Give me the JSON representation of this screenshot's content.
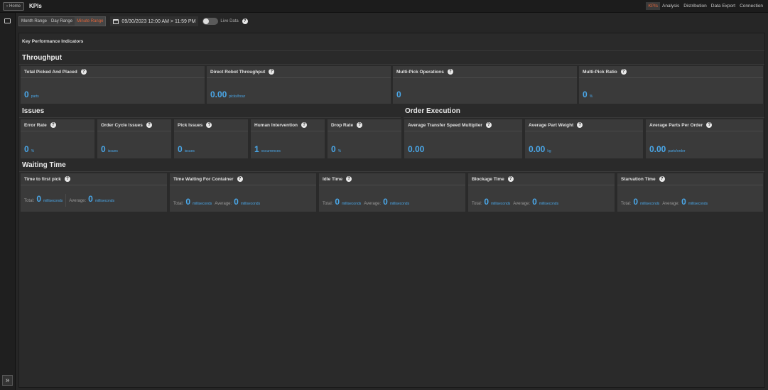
{
  "header": {
    "home_label": "Home",
    "title": "KPIs",
    "nav": [
      "KPIs",
      "Analysis",
      "Distribution",
      "Data Export",
      "Connection"
    ],
    "nav_active": "KPIs"
  },
  "toolbar": {
    "ranges": [
      "Month Range",
      "Day Range",
      "Minute Range"
    ],
    "range_active": "Minute Range",
    "date_range": "09/30/2023 12:00 AM > 11:59 PM",
    "live_label": "Live Data",
    "live_on": false
  },
  "panel": {
    "title": "Key Performance Indicators"
  },
  "throughput": {
    "title": "Throughput",
    "cards": [
      {
        "label": "Total Picked And Placed",
        "value": "0",
        "unit": "parts"
      },
      {
        "label": "Direct Robot Throughput",
        "value": "0.00",
        "unit": "picks/hour"
      },
      {
        "label": "Multi-Pick Operations",
        "value": "0",
        "unit": ""
      },
      {
        "label": "Multi-Pick Ratio",
        "value": "0",
        "unit": "%"
      }
    ]
  },
  "issues": {
    "title": "Issues",
    "cards": [
      {
        "label": "Error Rate",
        "value": "0",
        "unit": "%"
      },
      {
        "label": "Order Cycle Issues",
        "value": "0",
        "unit": "issues"
      },
      {
        "label": "Pick Issues",
        "value": "0",
        "unit": "issues"
      },
      {
        "label": "Human Intervention",
        "value": "1",
        "unit": "occurrences"
      },
      {
        "label": "Drop Rate",
        "value": "0",
        "unit": "%"
      }
    ]
  },
  "order_execution": {
    "title": "Order Execution",
    "cards": [
      {
        "label": "Average Transfer Speed Multiplier",
        "value": "0.00",
        "unit": ""
      },
      {
        "label": "Average Part Weight",
        "value": "0.00",
        "unit": "kg"
      },
      {
        "label": "Average Parts Per Order",
        "value": "0.00",
        "unit": "parts/order"
      }
    ]
  },
  "waiting_time": {
    "title": "Waiting Time",
    "total_label": "Total:",
    "average_label": "Average:",
    "cards": [
      {
        "label": "Time to first pick",
        "total": "0",
        "average": "0",
        "unit": "milliseconds"
      },
      {
        "label": "Time Waiting For Container",
        "total": "0",
        "average": "0",
        "unit": "milliseconds"
      },
      {
        "label": "Idle Time",
        "total": "0",
        "average": "0",
        "unit": "milliseconds"
      },
      {
        "label": "Blockage Time",
        "total": "0",
        "average": "0",
        "unit": "milliseconds"
      },
      {
        "label": "Starvation Time",
        "total": "0",
        "average": "0",
        "unit": "milliseconds"
      }
    ]
  },
  "colors": {
    "accent": "#e0643a",
    "value": "#4aa7e8"
  }
}
